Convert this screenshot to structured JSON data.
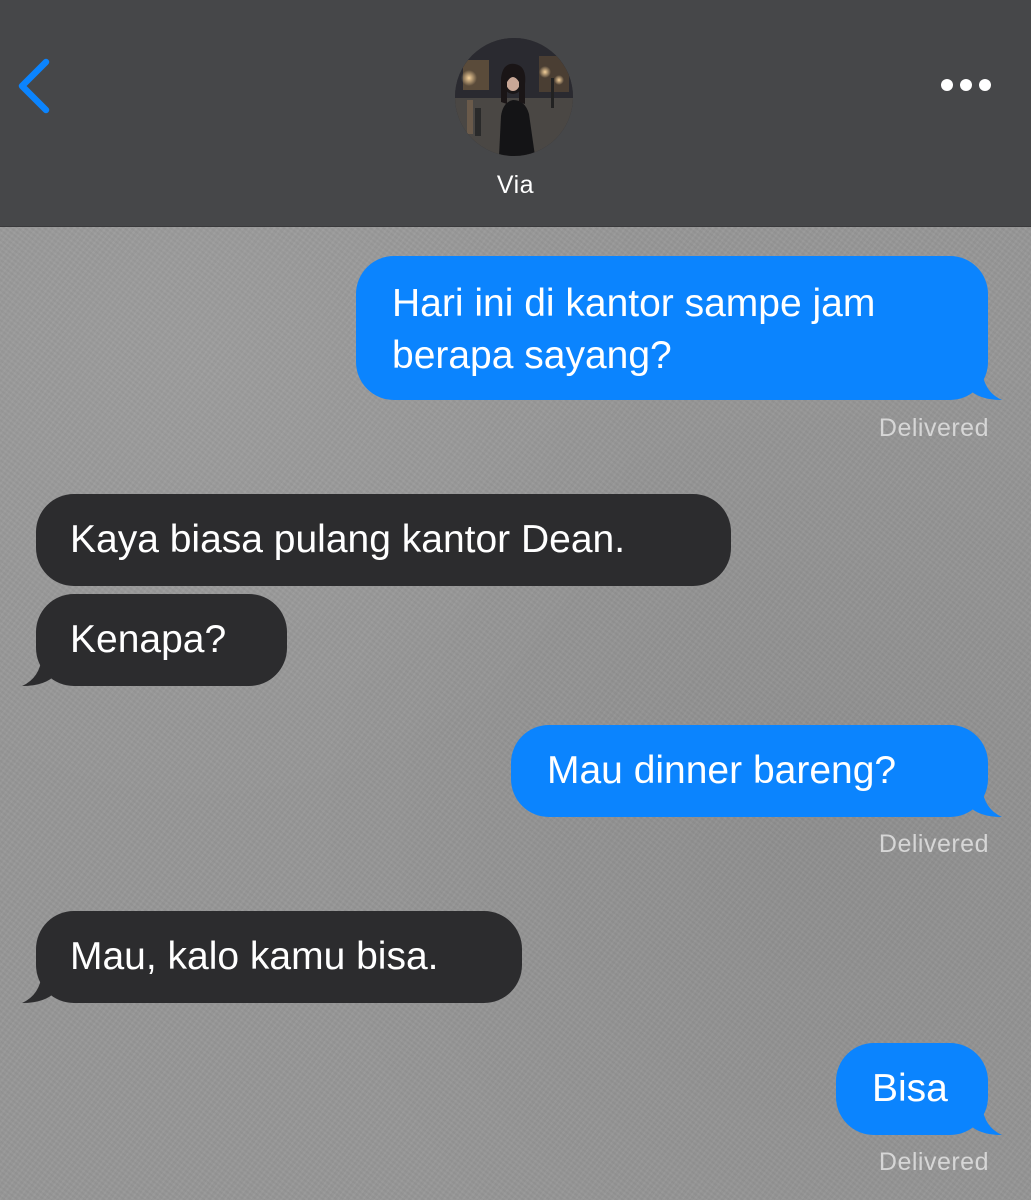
{
  "header": {
    "contact_name": "Via",
    "back_icon": "chevron-left-icon",
    "more_icon": "ellipsis-icon",
    "avatar": "contact-photo",
    "colors": {
      "header_bg": "#464749",
      "accent": "#0b84fe"
    }
  },
  "messages": [
    {
      "direction": "sent",
      "text_lines": [
        "Hari ini di kantor sampe jam",
        "berapa sayang?"
      ],
      "status": "Delivered"
    },
    {
      "direction": "received",
      "text": "Kaya biasa pulang kantor Dean."
    },
    {
      "direction": "received",
      "text": "Kenapa?"
    },
    {
      "direction": "sent",
      "text": "Mau dinner bareng?",
      "status": "Delivered"
    },
    {
      "direction": "received",
      "text": "Mau, kalo kamu bisa."
    },
    {
      "direction": "sent",
      "text": "Bisa",
      "status": "Delivered"
    }
  ],
  "colors": {
    "sent_bubble": "#0b84fe",
    "received_bubble": "#2c2c2e",
    "background": "#979797"
  }
}
